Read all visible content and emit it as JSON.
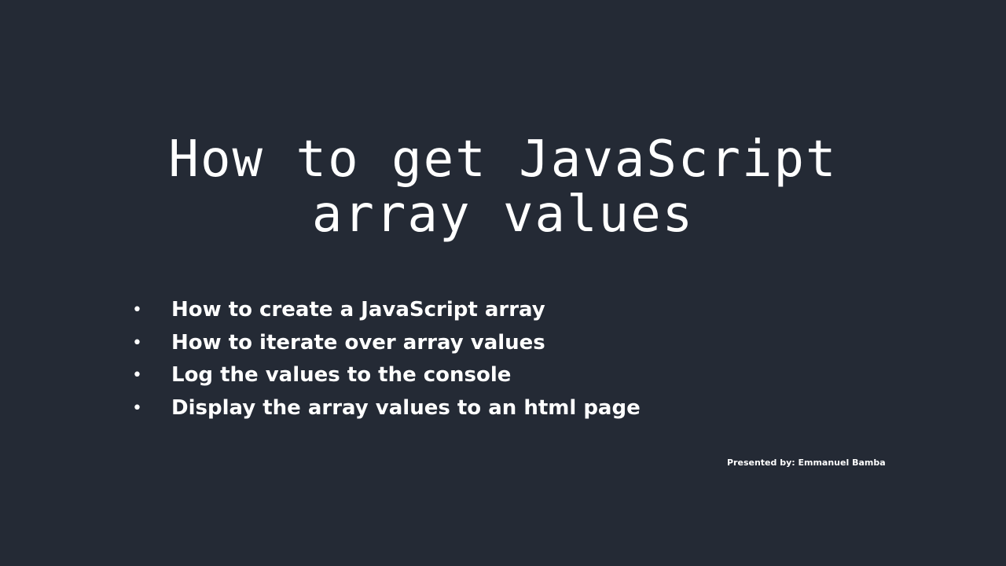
{
  "slide": {
    "title_line1": "How to get JavaScript",
    "title_line2": "array values",
    "bullet_char": "•",
    "bullets": [
      "How to create a JavaScript array",
      "How to iterate over array values",
      "Log the values to the console",
      "Display the array values to an html page"
    ],
    "presenter": "Presented by: Emmanuel Bamba"
  },
  "colors": {
    "background": "#242a35",
    "text": "#ffffff"
  }
}
